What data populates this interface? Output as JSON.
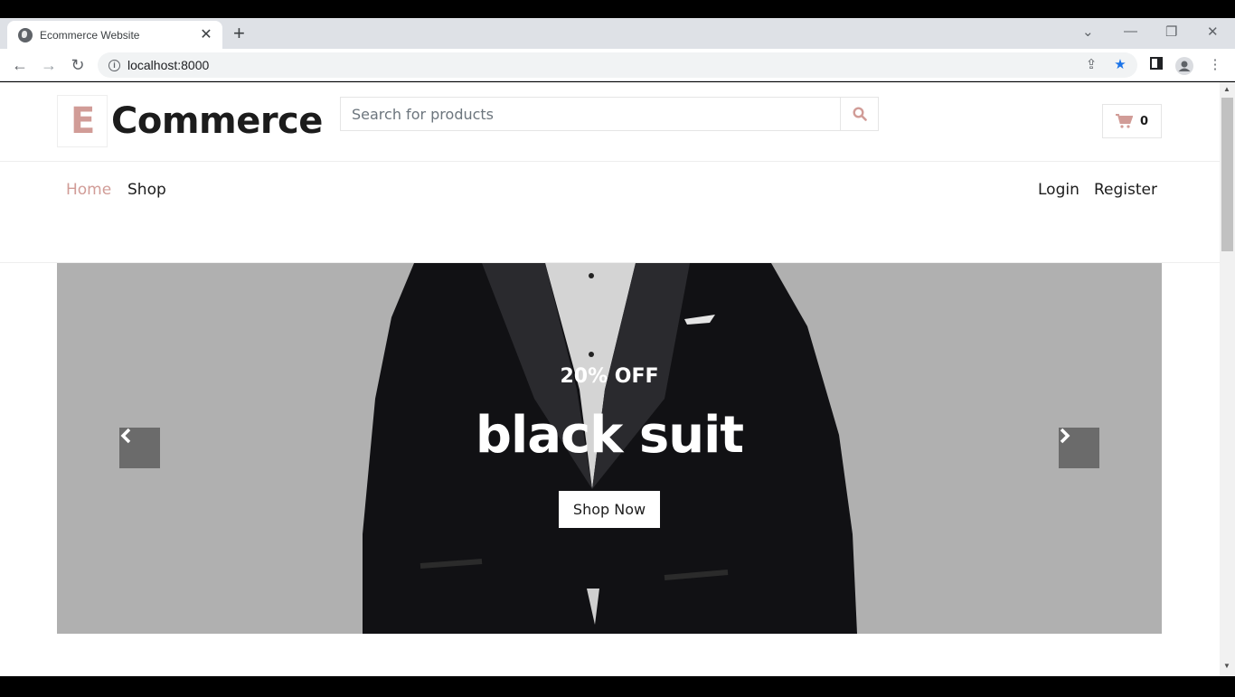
{
  "browser": {
    "tab_title": "Ecommerce Website",
    "tab_close": "✕",
    "new_tab": "+",
    "url": "localhost:8000",
    "icons": [
      "back-icon",
      "forward-icon",
      "reload-icon",
      "info-icon",
      "share-icon",
      "star-icon",
      "sidepanel-icon",
      "profile-icon",
      "menu-icon"
    ]
  },
  "site": {
    "logo_letter": "E",
    "logo_text": "Commerce",
    "search_placeholder": "Search for products",
    "cart_count": "0",
    "accent_color": "#d19c97"
  },
  "nav": {
    "home": "Home",
    "shop": "Shop",
    "login": "Login",
    "register": "Register"
  },
  "hero": {
    "discount": "20% OFF",
    "headline": "black suit",
    "cta": "Shop Now"
  }
}
